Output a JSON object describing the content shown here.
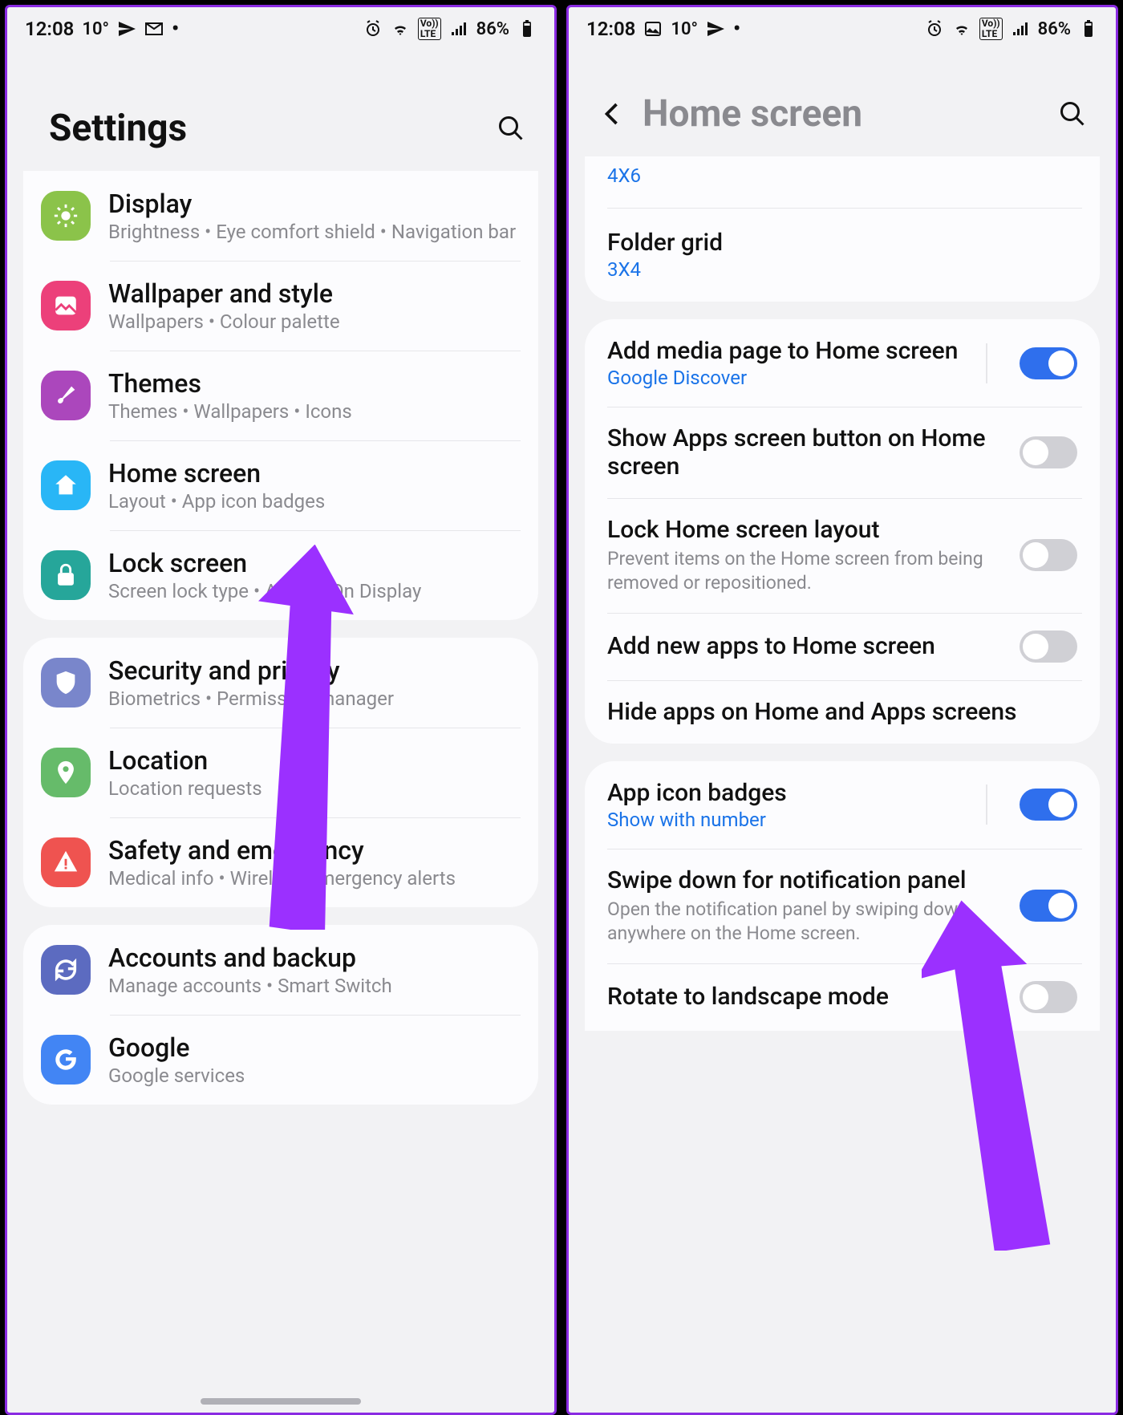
{
  "left": {
    "status": {
      "time": "12:08",
      "temp": "10°",
      "battery": "86%"
    },
    "title": "Settings",
    "groups": [
      [
        {
          "title": "Display",
          "sub": "Brightness  •  Eye comfort shield  •  Navigation bar",
          "icon": "sun-icon",
          "color": "#8bc34a"
        },
        {
          "title": "Wallpaper and style",
          "sub": "Wallpapers  •  Colour palette",
          "icon": "image-icon",
          "color": "#ec407a"
        },
        {
          "title": "Themes",
          "sub": "Themes  •  Wallpapers  •  Icons",
          "icon": "brush-icon",
          "color": "#ab47bc"
        },
        {
          "title": "Home screen",
          "sub": "Layout  •  App icon badges",
          "icon": "home-icon",
          "color": "#29b6f6"
        },
        {
          "title": "Lock screen",
          "sub": "Screen lock type  •  Always On Display",
          "icon": "lock-icon",
          "color": "#26a69a"
        }
      ],
      [
        {
          "title": "Security and privacy",
          "sub": "Biometrics  •  Permission manager",
          "icon": "shield-icon",
          "color": "#7986cb"
        },
        {
          "title": "Location",
          "sub": "Location requests",
          "icon": "pin-icon",
          "color": "#66bb6a"
        },
        {
          "title": "Safety and emergency",
          "sub": "Medical info  •  Wireless emergency alerts",
          "icon": "warning-icon",
          "color": "#ef5350"
        }
      ],
      [
        {
          "title": "Accounts and backup",
          "sub": "Manage accounts  •  Smart Switch",
          "icon": "sync-icon",
          "color": "#5c6bc0"
        },
        {
          "title": "Google",
          "sub": "Google services",
          "icon": "google-icon",
          "color": "#4285f4"
        }
      ]
    ]
  },
  "right": {
    "status": {
      "time": "12:08",
      "temp": "10°",
      "battery": "86%"
    },
    "title": "Home screen",
    "top": {
      "value0": "4X6",
      "folder_title": "Folder grid",
      "folder_value": "3X4"
    },
    "opts": [
      {
        "title": "Add media page to Home screen",
        "sub": "Google Discover",
        "subclass": "blue",
        "toggle": "on",
        "sep": true
      },
      {
        "title": "Show Apps screen button on Home screen",
        "toggle": "off"
      },
      {
        "title": "Lock Home screen layout",
        "desc": "Prevent items on the Home screen from being removed or repositioned.",
        "toggle": "off"
      },
      {
        "title": "Add new apps to Home screen",
        "toggle": "off"
      },
      {
        "title": "Hide apps on Home and Apps screens"
      }
    ],
    "opts2": [
      {
        "title": "App icon badges",
        "sub": "Show with number",
        "subclass": "blue",
        "toggle": "on",
        "sep": true
      },
      {
        "title": "Swipe down for notification panel",
        "desc": "Open the notification panel by swiping down anywhere on the Home screen.",
        "toggle": "on"
      },
      {
        "title": "Rotate to landscape mode",
        "toggle": "off"
      }
    ]
  }
}
